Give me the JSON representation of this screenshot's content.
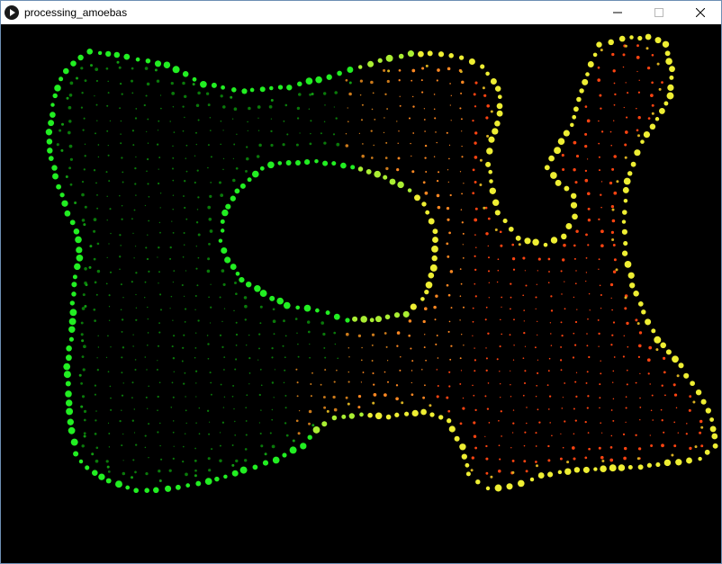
{
  "window": {
    "title": "processing_amoebas",
    "icon": "processing-play-icon",
    "controls": {
      "minimize_icon": "minimize-icon",
      "maximize_icon": "maximize-icon",
      "close_icon": "close-icon"
    }
  },
  "canvas": {
    "background": "#000000",
    "colors": {
      "outer_green": "#22ee22",
      "inner_green": "#0a7a0a",
      "yellow": "#eeee33",
      "orange": "#ff8822",
      "red_orange": "#ff4411"
    }
  }
}
